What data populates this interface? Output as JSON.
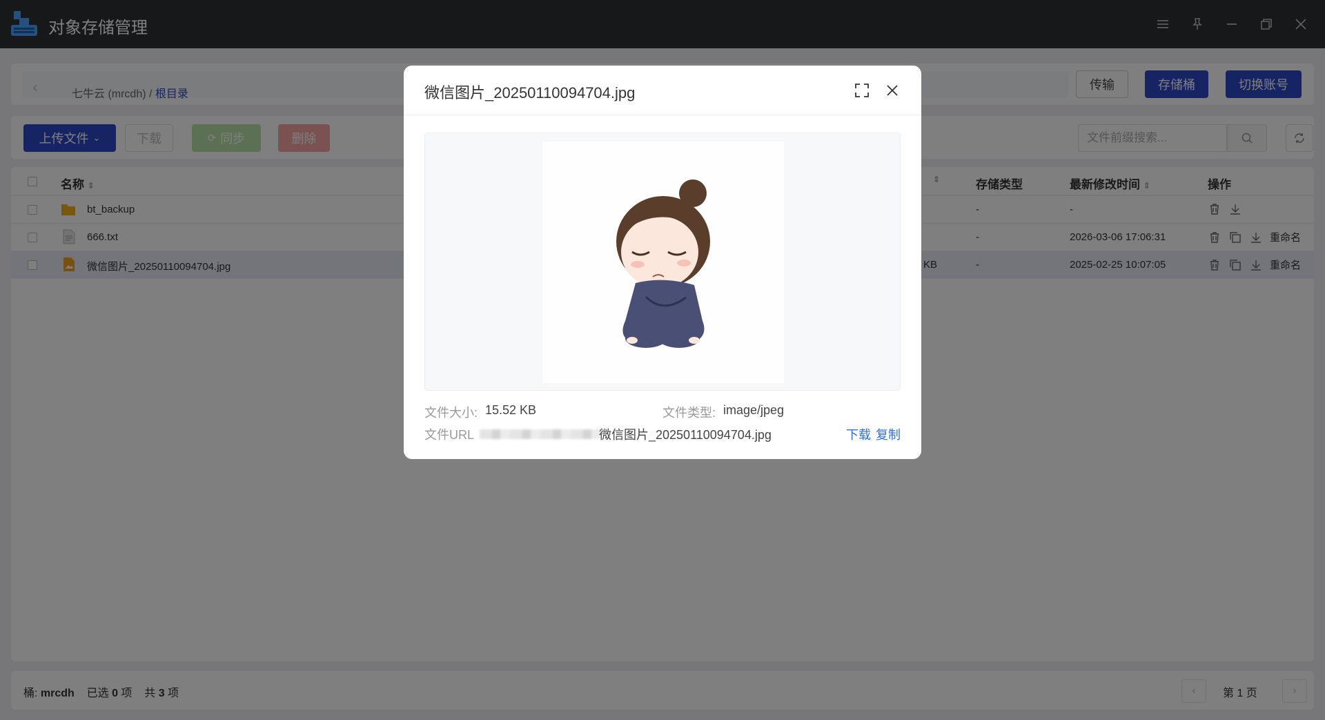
{
  "app": {
    "title": "对象存储管理",
    "window_icons": [
      "menu-icon",
      "pin-icon",
      "minimize-icon",
      "restore-icon",
      "close-icon"
    ]
  },
  "breadcrumb": {
    "provider": "七牛云 (mrcdh)",
    "separator": " / ",
    "root": "根目录"
  },
  "header_buttons": {
    "transfer": "传输",
    "bucket": "存储桶",
    "switch_account": "切换账号"
  },
  "toolbar": {
    "upload": "上传文件",
    "download": "下载",
    "sync": "同步",
    "delete": "删除",
    "search_placeholder": "文件前缀搜索..."
  },
  "table": {
    "columns": {
      "name": "名称",
      "storage_type": "存储类型",
      "modified": "最新修改时间",
      "ops": "操作"
    },
    "rows": [
      {
        "name": "bt_backup",
        "size_frag": "",
        "storage_type": "-",
        "modified": "-",
        "type": "folder"
      },
      {
        "name": "666.txt",
        "size_frag": "",
        "storage_type": "-",
        "modified": "2026-03-06 17:06:31",
        "type": "text",
        "rename": "重命名"
      },
      {
        "name": "微信图片_20250110094704.jpg",
        "size_frag": "KB",
        "storage_type": "-",
        "modified": "2025-02-25 10:07:05",
        "type": "image",
        "rename": "重命名"
      }
    ]
  },
  "footer": {
    "bucket_label": "桶:",
    "bucket_name": "mrcdh",
    "selected_label": "已选",
    "selected_count": "0",
    "selected_unit": "项",
    "total_label": "共",
    "total_count": "3",
    "total_unit": "项",
    "page": "第 1 页"
  },
  "modal": {
    "title": "微信图片_20250110094704.jpg",
    "size_label": "文件大小:",
    "size_value": "15.52 KB",
    "type_label": "文件类型:",
    "type_value": "image/jpeg",
    "url_label": "文件URL",
    "url_value_suffix": "微信图片_20250110094704.jpg",
    "download": "下载",
    "copy": "复制"
  },
  "colors": {
    "primary": "#2f49c7",
    "titlebar": "#2f3034",
    "link": "#2f6fd6",
    "folder": "#f2b11d"
  }
}
